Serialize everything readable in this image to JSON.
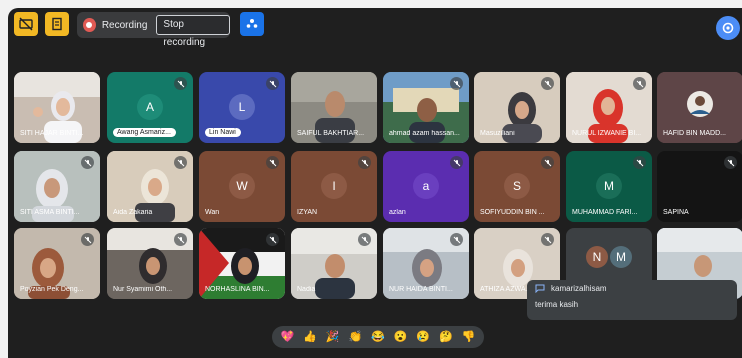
{
  "toolbar": {
    "recording_label": "Recording",
    "stop_recording_label": "Stop recording"
  },
  "participants": [
    {
      "name": "SITI HAJAR BINTI..."
    },
    {
      "name": "Awang Asmariz...",
      "initial": "A"
    },
    {
      "name": "Lin Nawi",
      "initial": "L"
    },
    {
      "name": "SAIFUL BAKHTIAR..."
    },
    {
      "name": "ahmad azam hassan..."
    },
    {
      "name": "Masuziliani"
    },
    {
      "name": "NURUL IZWANIE BI..."
    },
    {
      "name": "HAFID BIN MADD..."
    },
    {
      "name": "SITI ASMA BINTI..."
    },
    {
      "name": "Aida Zakaria"
    },
    {
      "name": "Wan",
      "initial": "W"
    },
    {
      "name": "IZYAN",
      "initial": "I"
    },
    {
      "name": "azlan",
      "initial": "a"
    },
    {
      "name": "SOFIYUDDIN BIN ...",
      "initial": "S"
    },
    {
      "name": "MUHAMMAD FARI...",
      "initial": "M"
    },
    {
      "name": "SAPINA"
    },
    {
      "name": "Poyzian Pek Deng..."
    },
    {
      "name": "Nur Syamimi Oth..."
    },
    {
      "name": "NORHASLINA BIN..."
    },
    {
      "name": "Nadia"
    },
    {
      "name": "NUR HAIDA BINTI..."
    },
    {
      "name": "ATHIZA AZWA..."
    }
  ],
  "group_tile": {
    "initials": [
      "N",
      "M"
    ]
  },
  "chat": {
    "sender": "kamarizalhisam",
    "message": "terima kasih"
  },
  "reactions": [
    "💖",
    "👍",
    "🎉",
    "👏",
    "😂",
    "😮",
    "😢",
    "🤔",
    "👎"
  ],
  "colors": {
    "background": "#1f1f1f",
    "toolbar_yellow": "#f2b824",
    "recording_red": "#e05a54",
    "accent_blue": "#1a73e8"
  }
}
